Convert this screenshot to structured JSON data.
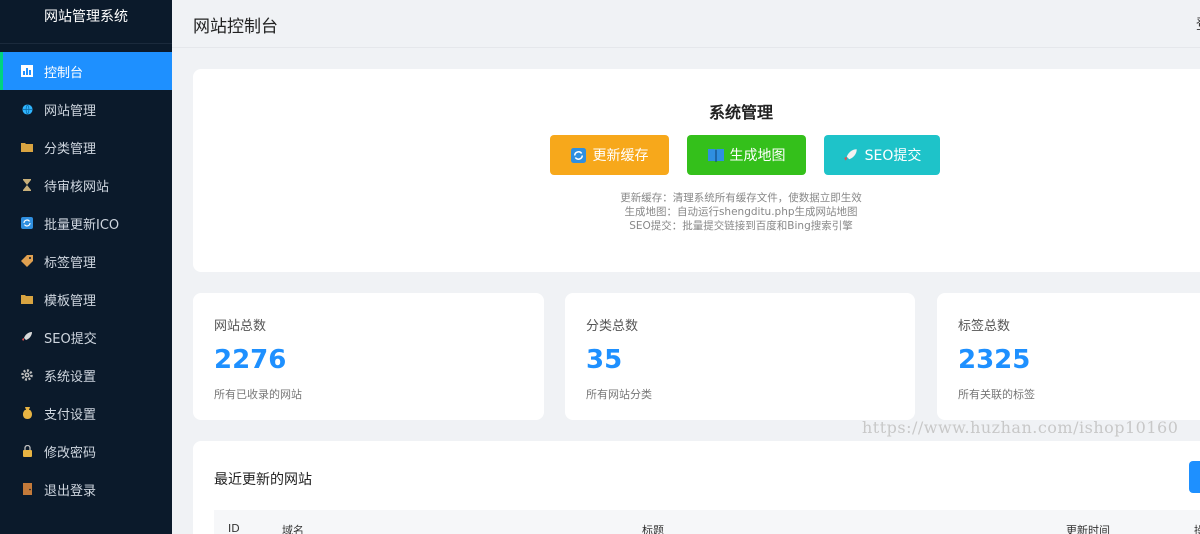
{
  "sidebar": {
    "brand": "网站管理系统",
    "items": [
      {
        "label": "控制台",
        "icon": "chart-icon",
        "color": "#ffffff",
        "active": true
      },
      {
        "label": "网站管理",
        "icon": "globe-icon",
        "color": "#2fb5ff"
      },
      {
        "label": "分类管理",
        "icon": "folder-icon",
        "color": "#d9a441"
      },
      {
        "label": "待审核网站",
        "icon": "hourglass-icon",
        "color": "#c9b07a"
      },
      {
        "label": "批量更新ICO",
        "icon": "refresh-icon",
        "color": "#2f8fe0"
      },
      {
        "label": "标签管理",
        "icon": "tag-icon",
        "color": "#e0a050"
      },
      {
        "label": "模板管理",
        "icon": "folder-icon",
        "color": "#d9a441"
      },
      {
        "label": "SEO提交",
        "icon": "rocket-icon",
        "color": "#d9d9d9"
      },
      {
        "label": "系统设置",
        "icon": "gear-icon",
        "color": "#bfbfbf"
      },
      {
        "label": "支付设置",
        "icon": "money-bag-icon",
        "color": "#e8b443"
      },
      {
        "label": "修改密码",
        "icon": "lock-icon",
        "color": "#e8b443"
      },
      {
        "label": "退出登录",
        "icon": "door-icon",
        "color": "#c47a3a"
      }
    ]
  },
  "header": {
    "title": "网站控制台",
    "right_text": "登"
  },
  "system": {
    "title": "系统管理",
    "buttons": {
      "refresh": "更新缓存",
      "sitemap": "生成地图",
      "seo": "SEO提交"
    },
    "desc": [
      "更新缓存：清理系统所有缓存文件，使数据立即生效",
      "生成地图：自动运行shengditu.php生成网站地图",
      "SEO提交：批量提交链接到百度和Bing搜索引擎"
    ]
  },
  "stats": [
    {
      "label": "网站总数",
      "value": "2276",
      "sub": "所有已收录的网站"
    },
    {
      "label": "分类总数",
      "value": "35",
      "sub": "所有网站分类"
    },
    {
      "label": "标签总数",
      "value": "2325",
      "sub": "所有关联的标签"
    }
  ],
  "watermark": "https://www.huzhan.com/ishop10160",
  "recent": {
    "title": "最近更新的网站",
    "columns": [
      "ID",
      "域名",
      "标题",
      "更新时间",
      "操"
    ]
  },
  "colors": {
    "accent": "#1e90ff",
    "sidebar_bg": "#0b1a2b",
    "orange": "#f7a81b",
    "green": "#34c01b",
    "teal": "#1ec3c9"
  }
}
